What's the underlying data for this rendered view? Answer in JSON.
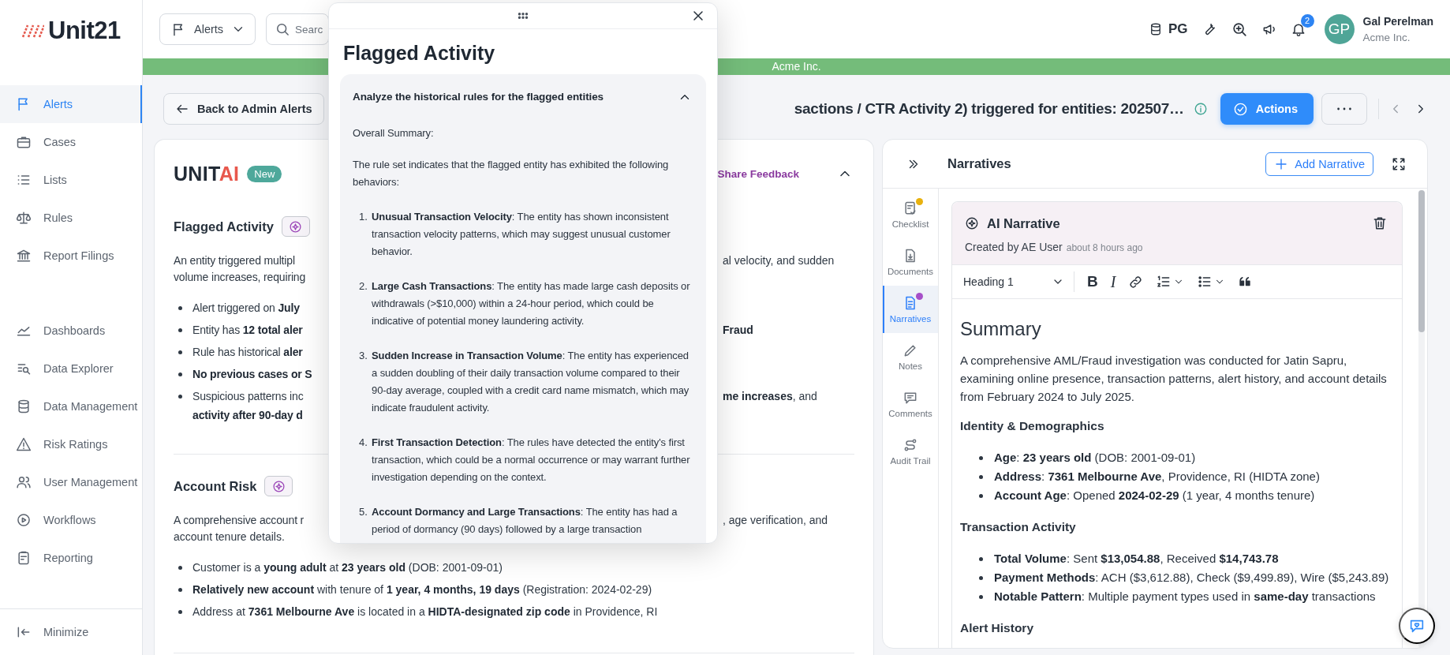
{
  "sidebar": {
    "logo": "Unit21",
    "items": [
      {
        "label": "Alerts",
        "selected": true
      },
      {
        "label": "Cases",
        "selected": false
      },
      {
        "label": "Lists",
        "selected": false
      },
      {
        "label": "Rules",
        "selected": false
      },
      {
        "label": "Report Filings",
        "selected": false
      }
    ],
    "tools": [
      {
        "label": "Dashboards",
        "selected": false
      },
      {
        "label": "Data Explorer",
        "selected": false
      },
      {
        "label": "Data Management",
        "selected": false
      },
      {
        "label": "Risk Ratings",
        "selected": false
      },
      {
        "label": "User Management",
        "selected": false
      },
      {
        "label": "Workflows",
        "selected": false
      },
      {
        "label": "Reporting",
        "selected": false
      }
    ],
    "minimize": "Minimize"
  },
  "topbar": {
    "module": "Alerts",
    "search": {
      "placeholder": "Searc"
    },
    "env": "PG",
    "notifications": "2",
    "user": {
      "initials": "GP",
      "name": "Gal Perelman",
      "org": "Acme Inc."
    }
  },
  "banner": "Acme Inc.",
  "page_header": {
    "back": "Back to Admin Alerts",
    "title": "sactions / CTR Activity 2) triggered for entities: 202507…",
    "actions": "Actions"
  },
  "unitai": {
    "brand": "UNIT",
    "brand_accent": "AI",
    "badge": "New",
    "feedback": "Share Feedback",
    "expanded": true,
    "sections": [
      {
        "title": "Flagged Activity",
        "lines": [
          {
            "kind": "paragraph",
            "left": "An entity triggered multipl",
            "right": "al velocity, and sudden"
          },
          {
            "kind": "paragraph",
            "left": "volume increases, requiring"
          },
          {
            "kind": "bullet",
            "left": "Alert triggered on **July**"
          },
          {
            "kind": "bullet",
            "left": "Entity has **12 total aler**",
            "right": "**Fraud**"
          },
          {
            "kind": "bullet",
            "left": "Rule has historical **aler**"
          },
          {
            "kind": "bullet",
            "left": "**No previous cases or S**"
          },
          {
            "kind": "bullet",
            "left": "Suspicious patterns inc",
            "right": "**me increases**, and"
          },
          {
            "kind": "continuation",
            "left": "**activity after 90-day d**"
          }
        ]
      },
      {
        "title": "Account Risk",
        "lines": [
          {
            "kind": "paragraph",
            "left": "A comprehensive account r",
            "right": ", age verification, and"
          },
          {
            "kind": "paragraph",
            "text": "account tenure details."
          },
          {
            "kind": "bullet",
            "text": "Customer is a **young adult** at **23 years old** (DOB: 2001-09-01)"
          },
          {
            "kind": "bullet",
            "text": "**Relatively new account** with tenure of **1 year, 4 months, 19 days** (Registration: 2024-02-29)"
          },
          {
            "kind": "bullet",
            "text": "Address at **7361 Melbourne Ave** is located in a **HIDTA-designated zip code** in Providence, RI"
          }
        ]
      }
    ]
  },
  "narratives": {
    "title": "Narratives",
    "add": "Add Narrative",
    "rail": [
      {
        "label": "Checklist",
        "selected": false,
        "color": "#e8b10e"
      },
      {
        "label": "Documents",
        "selected": false
      },
      {
        "label": "Narratives",
        "selected": true,
        "color": "#a64fc8"
      },
      {
        "label": "Notes",
        "selected": false
      },
      {
        "label": "Comments",
        "selected": false
      },
      {
        "label": "Audit Trail",
        "selected": false
      }
    ],
    "narrative": {
      "title": "AI Narrative",
      "author": "Created by AE User",
      "time": "about 8 hours ago",
      "toolbar": {
        "style": "Heading 1",
        "bold": "B",
        "italic": "I"
      },
      "blocks": [
        {
          "kind": "title",
          "text": "Summary"
        },
        {
          "kind": "paragraph",
          "text": "A comprehensive AML/Fraud investigation was conducted for Jatin Sapru, examining online presence, transaction patterns, alert history, and account details from February 2024 to July 2025."
        },
        {
          "kind": "heading",
          "text": "Identity & Demographics"
        },
        {
          "kind": "bullets",
          "items": [
            "**Age**: **23 years old** (DOB: 2001-09-01)",
            "**Address**: **7361 Melbourne Ave**, Providence, RI (HIDTA zone)",
            "**Account Age**: Opened **2024-02-29** (1 year, 4 months tenure)"
          ]
        },
        {
          "kind": "heading",
          "text": "Transaction Activity"
        },
        {
          "kind": "bullets",
          "items": [
            "**Total Volume**: Sent **$13,054.88**, Received **$14,743.78**",
            "**Payment Methods**: ACH ($3,612.88), Check ($9,499.89), Wire ($5,243.89)",
            "**Notable Pattern**: Multiple payment types used in **same-day** transactions"
          ]
        },
        {
          "kind": "heading",
          "text": "Alert History"
        }
      ]
    }
  },
  "popup": {
    "title": "Flagged Activity",
    "panel": {
      "title": "Analyze the historical rules for the flagged entities",
      "expanded": true,
      "intro": "Overall Summary:",
      "lead": "The rule set indicates that the flagged entity has exhibited the following behaviors:",
      "items": [
        {
          "number": "1.",
          "text": "**Unusual Transaction Velocity**: The entity has shown inconsistent transaction velocity patterns, which may suggest unusual customer behavior."
        },
        {
          "number": "2.",
          "text": "**Large Cash Transactions**: The entity has made large cash deposits or withdrawals (>$10,000) within a 24-hour period, which could be indicative of potential money laundering activity."
        },
        {
          "number": "3.",
          "text": "**Sudden Increase in Transaction Volume**: The entity has experienced a sudden doubling of their daily transaction volume compared to their 90-day average, coupled with a credit card name mismatch, which may indicate fraudulent activity."
        },
        {
          "number": "4.",
          "text": "**First Transaction Detection**: The rules have detected the entity's first transaction, which could be a normal occurrence or may warrant further investigation depending on the context."
        },
        {
          "number": "5.",
          "text": "**Account Dormancy and Large Transactions**: The entity has had a period of dormancy (90 days) followed by a large transaction"
        }
      ]
    }
  }
}
